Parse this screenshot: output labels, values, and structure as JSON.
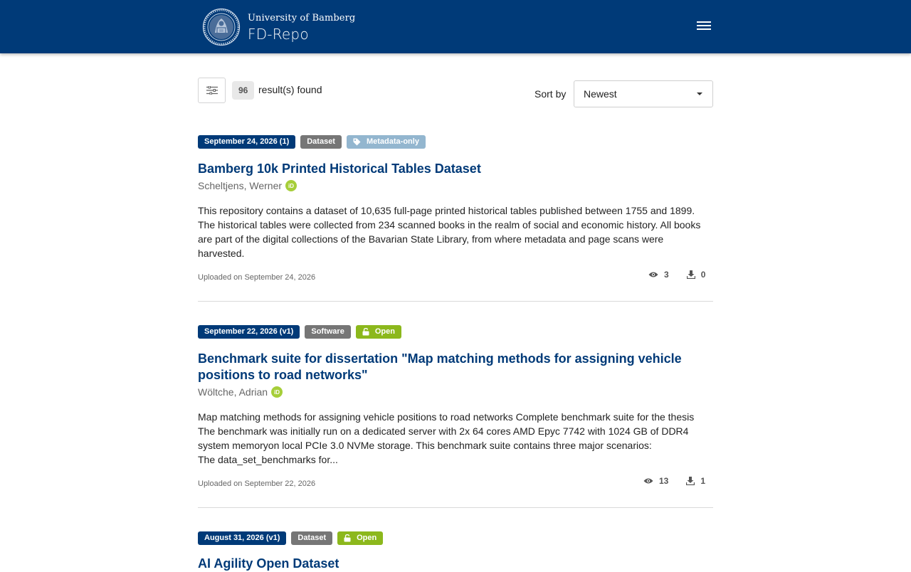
{
  "header": {
    "logo_sub": "University of Bamberg",
    "logo_main": "FD-Repo",
    "brand_color": "#003a78"
  },
  "search": {
    "result_count": "96",
    "result_text": "result(s) found",
    "sort_label": "Sort by",
    "sort_value": "Newest"
  },
  "records": [
    {
      "date_label": "September 24, 2026 (1)",
      "type_label": "Dataset",
      "access_label": "Metadata-only",
      "access_icon": "tag-icon",
      "title": "Bamberg 10k Printed Historical Tables Dataset",
      "author": "Scheltjens, Werner",
      "description_lines": [
        "This repository contains a dataset of 10,635 full-page printed historical tables published between 1755 and 1899.",
        "The historical tables were collected from 234 scanned books in the realm of social and economic history. All books",
        "are part of the digital collections of the Bavarian State Library, from where metadata and page scans were",
        "harvested."
      ],
      "uploaded": "Uploaded on September 24, 2026",
      "views": "3",
      "downloads": "0"
    },
    {
      "date_label": "September 22, 2026 (v1)",
      "type_label": "Software",
      "access_label": "Open",
      "access_icon": "unlock-icon",
      "title": "Benchmark suite for dissertation \"Map matching methods for assigning vehicle positions to road networks\"",
      "author": "Wöltche, Adrian",
      "description_lines": [
        "Map matching methods for assigning vehicle positions to road networks Complete benchmark suite for the thesis",
        "The benchmark was initially run on a dedicated server with 2x 64 cores AMD Epyc 7742 with 1024 GB of DDR4",
        "system memoryon local PCIe 3.0 NVMe storage. This benchmark suite contains three major scenarios:",
        "The data_set_benchmarks for..."
      ],
      "uploaded": "Uploaded on September 22, 2026",
      "views": "13",
      "downloads": "1"
    },
    {
      "date_label": "August 31, 2026 (v1)",
      "type_label": "Dataset",
      "access_label": "Open",
      "access_icon": "unlock-icon",
      "title": "AI Agility Open Dataset"
    }
  ]
}
